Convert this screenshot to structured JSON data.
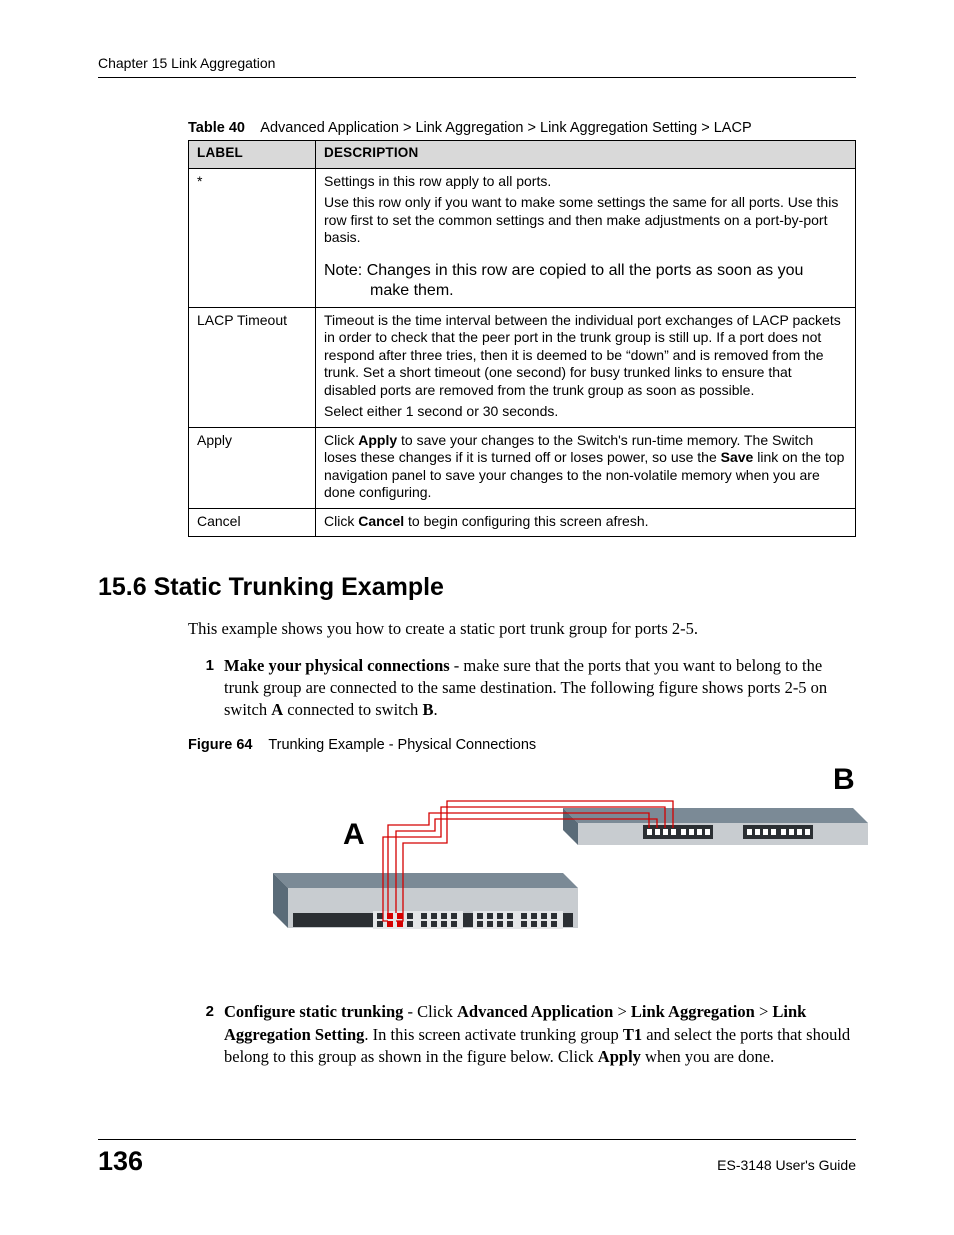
{
  "header": {
    "running": "Chapter 15 Link Aggregation"
  },
  "table": {
    "caption_label": "Table 40",
    "caption_text": "Advanced Application > Link Aggregation > Link Aggregation Setting > LACP",
    "head_label": "LABEL",
    "head_desc": "DESCRIPTION",
    "rows": {
      "star": {
        "label": "*",
        "p1": "Settings in this row apply to all ports.",
        "p2": "Use this row only if you want to make some settings the same for all ports. Use this row first to set the common settings and then make adjustments on a port-by-port basis.",
        "note1": "Note: Changes in this row are copied to all the ports as soon as you",
        "note2": "make them."
      },
      "timeout": {
        "label": "LACP Timeout",
        "p1": "Timeout is the time interval between the individual port exchanges of LACP packets in order to check that the peer port in the trunk group is still up. If a port does not respond after three tries, then it is deemed to be “down” and is removed from the trunk. Set a short timeout (one second) for busy trunked links to ensure that disabled ports are removed from the trunk group as soon as possible.",
        "p2": "Select either 1 second or 30 seconds."
      },
      "apply": {
        "label": "Apply",
        "t_pre": "Click ",
        "t_b1": "Apply",
        "t_mid": " to save your changes to the Switch's run-time memory. The Switch loses these changes if it is turned off or loses power, so use the ",
        "t_b2": "Save",
        "t_post": " link on the top navigation panel to save your changes to the non-volatile memory when you are done configuring."
      },
      "cancel": {
        "label": "Cancel",
        "t_pre": "Click ",
        "t_b1": "Cancel",
        "t_post": " to begin configuring this screen afresh."
      }
    }
  },
  "section": {
    "heading": "15.6  Static Trunking Example",
    "intro": "This example shows you how to create a static port trunk group for ports 2-5.",
    "step1": {
      "num": "1",
      "b1": "Make your physical connections",
      "t1": " - make sure that the ports that you want to belong to the trunk group are connected to the same destination. The following figure shows ports 2-5 on switch ",
      "b2": "A",
      "t2": " connected to switch ",
      "b3": "B",
      "t3": "."
    },
    "figcap": {
      "label": "Figure 64",
      "text": "Trunking Example - Physical Connections"
    },
    "figletters": {
      "a": "A",
      "b": "B"
    },
    "step2": {
      "num": "2",
      "b1": "Configure static trunking",
      "t1": " - Click ",
      "b2": "Advanced Application",
      "t2": " > ",
      "b3": "Link Aggregation",
      "t3": " > ",
      "b4": "Link Aggregation Setting",
      "t4": ". In this screen activate trunking group ",
      "b5": "T1",
      "t5": " and select the ports that should belong to this group as shown in the figure below. Click ",
      "b6": "Apply",
      "t6": " when you are done."
    }
  },
  "footer": {
    "page": "136",
    "doc": "ES-3148 User's Guide"
  }
}
